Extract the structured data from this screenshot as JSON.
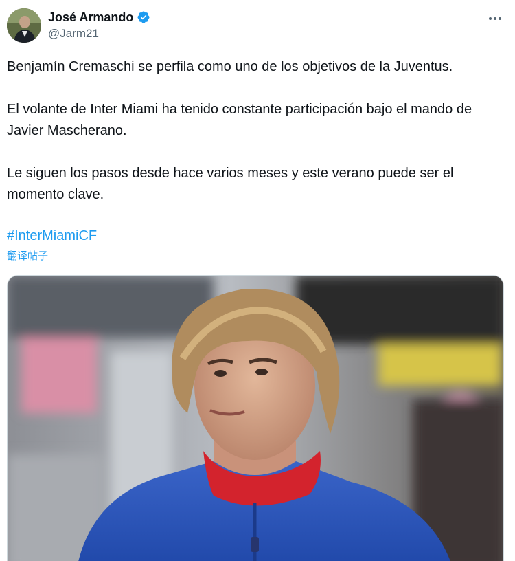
{
  "author": {
    "display_name": "José Armando",
    "handle": "@Jarm21",
    "avatar_icon": "user-avatar",
    "verified_icon": "verified-badge-icon"
  },
  "tweet": {
    "paragraphs": [
      "Benjamín Cremaschi se perfila como uno de los objetivos de la Juventus.",
      "El volante de Inter Miami ha tenido constante participación bajo el mando de Javier Mascherano.",
      "Le siguen los pasos desde hace varios meses y este verano puede ser el momento clave."
    ],
    "hashtag": "#InterMiamiCF",
    "translate_label": "翻译帖子"
  },
  "colors": {
    "link": "#1d9bf0",
    "text": "#0f1419",
    "secondary": "#536471"
  }
}
